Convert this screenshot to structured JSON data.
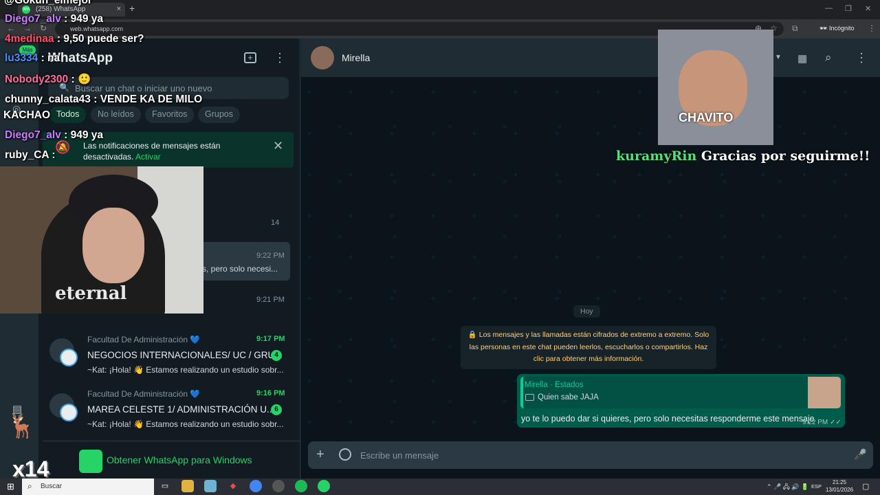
{
  "browser": {
    "tab_title": "(258) WhatsApp",
    "tab_favicon": "WA",
    "url": "web.whatsapp.com",
    "incognito_label": "Incógnito"
  },
  "whatsapp": {
    "title": "WhatsApp",
    "rail_more_label": "Más",
    "search_placeholder": "Buscar un chat o iniciar uno nuevo",
    "filters": [
      "Todos",
      "No leídos",
      "Favoritos",
      "Grupos"
    ],
    "notification": {
      "text": "Las notificaciones de mensajes están",
      "text2": "desactivadas.",
      "action": "Activar"
    },
    "chats": [
      {
        "time": "14"
      },
      {
        "time": "9:22 PM",
        "preview": "s, pero solo necesi..."
      },
      {
        "time": "9:21 PM"
      },
      {
        "group": "Facultad De Administración 💙",
        "time": "9:17 PM",
        "name": "NEGOCIOS INTERNACIONALES/ UC / GRU...",
        "unread": "4",
        "preview": "~Kat: ¡Hola! 👋 Estamos realizando un estudio sobr..."
      },
      {
        "group": "Facultad De Administración 💙",
        "time": "9:16 PM",
        "name": "MAREA CELESTE 1/ ADMINISTRACIÓN U...",
        "unread": "6",
        "preview": "~Kat: ¡Hola! 👋 Estamos realizando un estudio sobr..."
      }
    ],
    "get_app_label": "Obtener WhatsApp para Windows"
  },
  "conversation": {
    "contact_name": "Mirella",
    "day_label": "Hoy",
    "e2e_notice": "🔒 Los mensajes y las llamadas están cifrados de extremo a extremo. Solo las personas en este chat pueden leerlos, escucharlos o compartirlos. Haz clic para obtener más información.",
    "message": {
      "quote_author": "Mirella · Estados",
      "quote_text": "Quien sabe JAJA",
      "text": "yo te lo puedo dar si quieres, pero solo necesitas responderme este mensaje",
      "time": "9:22 PM ✓✓"
    },
    "composer_placeholder": "Escribe un mensaje"
  },
  "stream_overlay": {
    "top_partial": "@Gokuh_elmejor",
    "chat_lines": [
      {
        "user": "Diego7_alv",
        "user_color": "#c77dff",
        "text": " : 949 ya"
      },
      {
        "user": "4medinaa",
        "user_color": "#ff4f6d",
        "text": " : 9,50 puede ser?"
      },
      {
        "user": "lu3334",
        "user_color": "#4f8cff",
        "text": " : na"
      },
      {
        "user": "Nobody2300",
        "user_color": "#ff6b9a",
        "text": " : 🙂"
      },
      {
        "user": "chunny_calata43",
        "user_color": "#e9edef",
        "text": " : VENDE KA DE MILO"
      },
      {
        "user": "KACHAO",
        "user_color": "#e9edef",
        "text": ""
      },
      {
        "user": "Diego7_alv",
        "user_color": "#c77dff",
        "text": " : 949 ya"
      },
      {
        "user": "ruby_CA",
        "user_color": "#e9edef",
        "text": " :"
      }
    ],
    "webcam_shirt_text": "eternal",
    "alert_label": "CHAVITO",
    "alert_user": "kuramyRin",
    "alert_text": " Gracias por seguirme!!",
    "badge_text": "x14"
  },
  "taskbar": {
    "search_label": "Buscar",
    "language": "ESP",
    "time": "21:25",
    "date": "13/01/2026"
  },
  "colors": {
    "accent": "#25d366",
    "panel": "#111b21",
    "bubble_out": "#005c4b",
    "notice_text": "#ffd279"
  }
}
